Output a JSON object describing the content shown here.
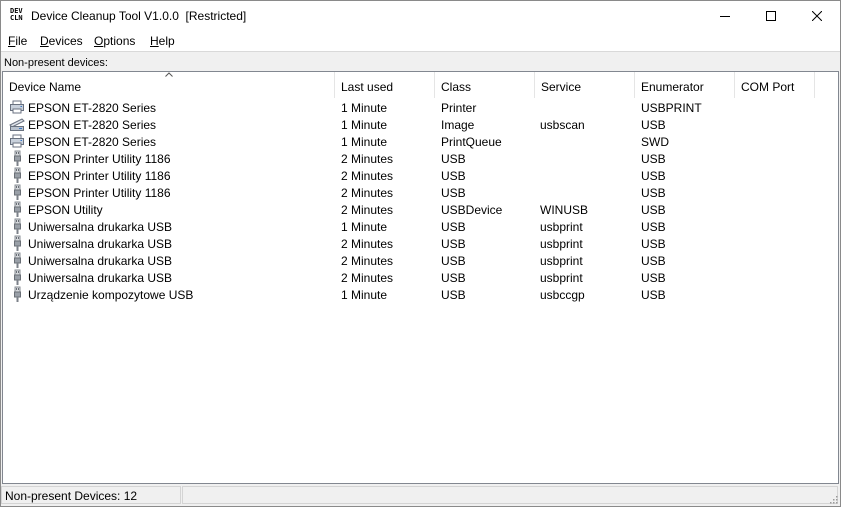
{
  "window": {
    "title": "Device Cleanup Tool V1.0.0  [Restricted]",
    "app_icon_top": "DEV",
    "app_icon_bottom": "CLN"
  },
  "menu": [
    {
      "u": "F",
      "rest": "ile"
    },
    {
      "u": "D",
      "rest": "evices"
    },
    {
      "u": "O",
      "rest": "ptions"
    },
    {
      "u": "H",
      "rest": "elp"
    }
  ],
  "section_label": "Non-present devices:",
  "columns": [
    "Device Name",
    "Last used",
    "Class",
    "Service",
    "Enumerator",
    "COM Port"
  ],
  "rows": [
    {
      "icon": "printer-icon",
      "name": "EPSON ET-2820 Series",
      "last_used": "1 Minute",
      "class": "Printer",
      "service": "",
      "enumerator": "USBPRINT",
      "com": ""
    },
    {
      "icon": "scanner-icon",
      "name": "EPSON ET-2820 Series",
      "last_used": "1 Minute",
      "class": "Image",
      "service": "usbscan",
      "enumerator": "USB",
      "com": ""
    },
    {
      "icon": "printer-icon",
      "name": "EPSON ET-2820 Series",
      "last_used": "1 Minute",
      "class": "PrintQueue",
      "service": "",
      "enumerator": "SWD",
      "com": ""
    },
    {
      "icon": "usb-plug-icon",
      "name": "EPSON Printer Utility 1186",
      "last_used": "2 Minutes",
      "class": "USB",
      "service": "",
      "enumerator": "USB",
      "com": ""
    },
    {
      "icon": "usb-plug-icon",
      "name": "EPSON Printer Utility 1186",
      "last_used": "2 Minutes",
      "class": "USB",
      "service": "",
      "enumerator": "USB",
      "com": ""
    },
    {
      "icon": "usb-plug-icon",
      "name": "EPSON Printer Utility 1186",
      "last_used": "2 Minutes",
      "class": "USB",
      "service": "",
      "enumerator": "USB",
      "com": ""
    },
    {
      "icon": "usb-plug-icon",
      "name": "EPSON Utility",
      "last_used": "2 Minutes",
      "class": "USBDevice",
      "service": "WINUSB",
      "enumerator": "USB",
      "com": ""
    },
    {
      "icon": "usb-plug-icon",
      "name": "Uniwersalna drukarka USB",
      "last_used": "1 Minute",
      "class": "USB",
      "service": "usbprint",
      "enumerator": "USB",
      "com": ""
    },
    {
      "icon": "usb-plug-icon",
      "name": "Uniwersalna drukarka USB",
      "last_used": "2 Minutes",
      "class": "USB",
      "service": "usbprint",
      "enumerator": "USB",
      "com": ""
    },
    {
      "icon": "usb-plug-icon",
      "name": "Uniwersalna drukarka USB",
      "last_used": "2 Minutes",
      "class": "USB",
      "service": "usbprint",
      "enumerator": "USB",
      "com": ""
    },
    {
      "icon": "usb-plug-icon",
      "name": "Uniwersalna drukarka USB",
      "last_used": "2 Minutes",
      "class": "USB",
      "service": "usbprint",
      "enumerator": "USB",
      "com": ""
    },
    {
      "icon": "usb-plug-icon",
      "name": "Urządzenie kompozytowe USB",
      "last_used": "1 Minute",
      "class": "USB",
      "service": "usbccgp",
      "enumerator": "USB",
      "com": ""
    }
  ],
  "status": {
    "text": "Non-present Devices: 12"
  }
}
